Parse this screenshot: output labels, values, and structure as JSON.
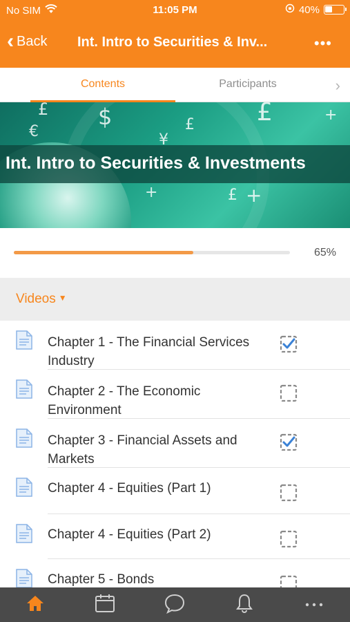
{
  "status_bar": {
    "carrier": "No SIM",
    "time": "11:05 PM",
    "battery": "40%"
  },
  "nav": {
    "back_label": "Back",
    "title": "Int. Intro to Securities & Inv...",
    "more_label": "•••"
  },
  "tabs": {
    "contents": "Contents",
    "participants": "Participants"
  },
  "banner": {
    "title": "Int. Intro to Securities & Investments"
  },
  "progress": {
    "value": 0.65,
    "label": "65%"
  },
  "section": {
    "label": "Videos"
  },
  "items": [
    {
      "title": "Chapter 1 - The Financial Services Industry",
      "checked": true
    },
    {
      "title": "Chapter 2 - The Economic Environment",
      "checked": false
    },
    {
      "title": "Chapter 3 - Financial Assets and Markets",
      "checked": true
    },
    {
      "title": "Chapter 4 - Equities (Part 1)",
      "checked": false
    },
    {
      "title": "Chapter 4 - Equities (Part 2)",
      "checked": false
    },
    {
      "title": "Chapter 5 - Bonds",
      "checked": false
    }
  ],
  "tab_bar": {
    "items": [
      "home-icon",
      "calendar-icon",
      "chat-icon",
      "bell-icon",
      "more-icon"
    ],
    "active": "home-icon"
  },
  "colors": {
    "accent": "#f7861d",
    "progress_fill": "#f39a47",
    "checkbox_check": "#3b82d6",
    "tab_bar": "#4a4a4a"
  }
}
